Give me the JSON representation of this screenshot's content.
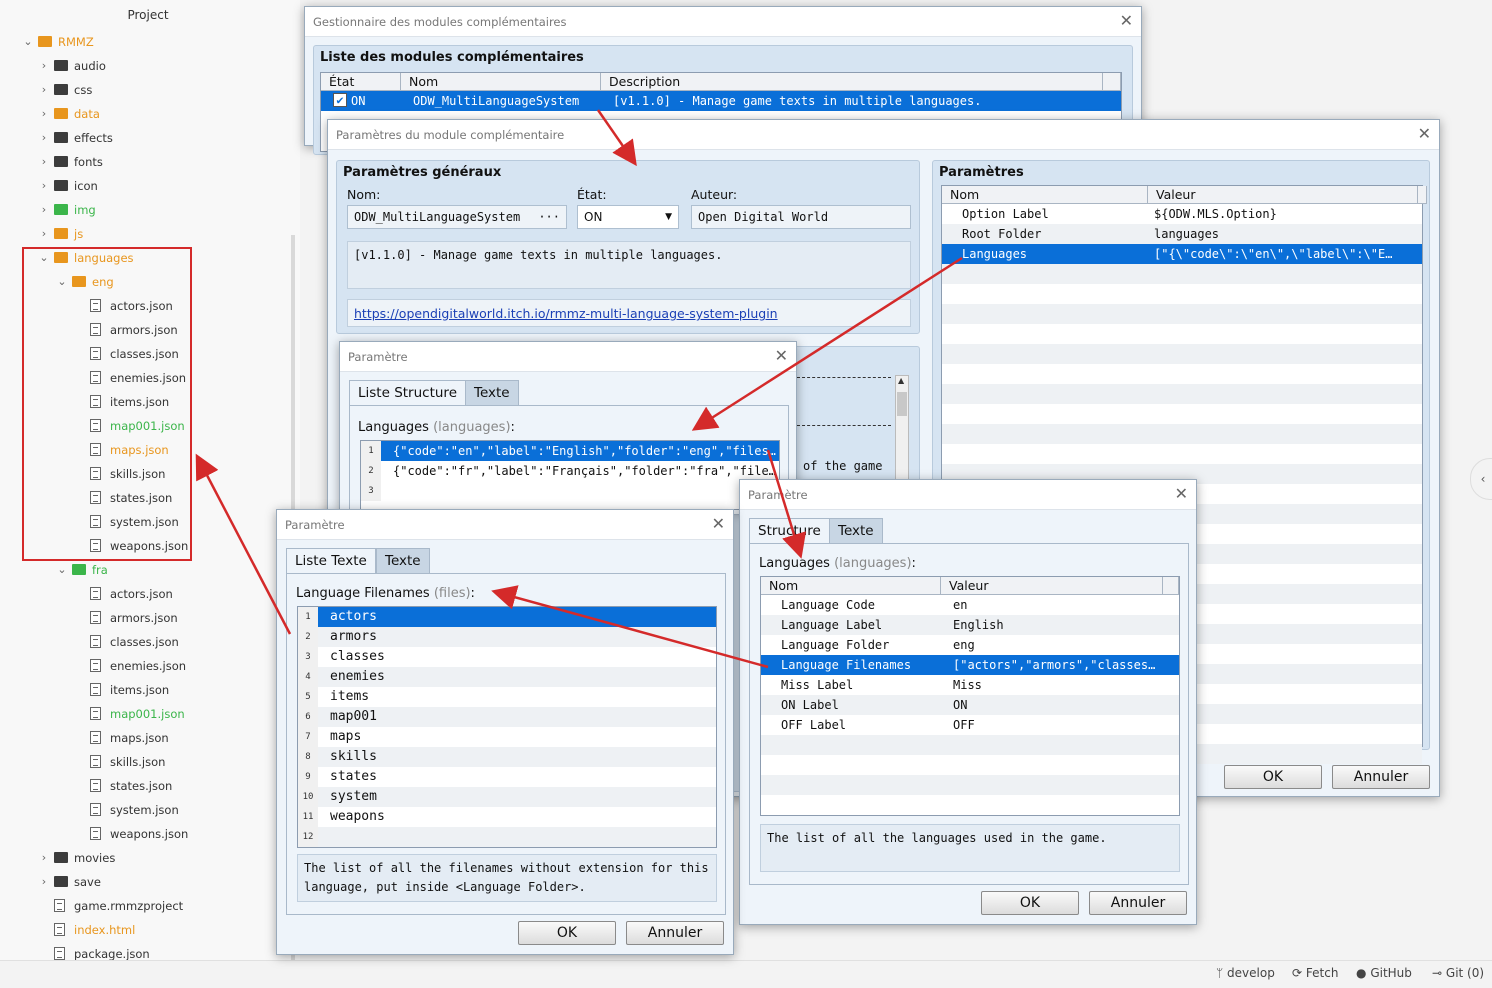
{
  "explorer": {
    "title": "Project",
    "items": [
      {
        "label": "RMMZ",
        "color": "orange",
        "chev": "v",
        "icon": "folder-orange",
        "indent": 0
      },
      {
        "label": "audio",
        "color": "",
        "chev": ">",
        "icon": "folder",
        "indent": 1
      },
      {
        "label": "css",
        "color": "",
        "chev": ">",
        "icon": "folder",
        "indent": 1
      },
      {
        "label": "data",
        "color": "orange",
        "chev": ">",
        "icon": "folder-orange",
        "indent": 1
      },
      {
        "label": "effects",
        "color": "",
        "chev": ">",
        "icon": "folder",
        "indent": 1
      },
      {
        "label": "fonts",
        "color": "",
        "chev": ">",
        "icon": "folder",
        "indent": 1
      },
      {
        "label": "icon",
        "color": "",
        "chev": ">",
        "icon": "folder",
        "indent": 1
      },
      {
        "label": "img",
        "color": "green",
        "chev": ">",
        "icon": "folder-green",
        "indent": 1
      },
      {
        "label": "js",
        "color": "orange",
        "chev": ">",
        "icon": "folder-orange",
        "indent": 1
      },
      {
        "label": "languages",
        "color": "orange",
        "chev": "v",
        "icon": "folder-orange",
        "indent": 1
      },
      {
        "label": "eng",
        "color": "orange",
        "chev": "v",
        "icon": "folder-orange",
        "indent": 2
      },
      {
        "label": "actors.json",
        "color": "",
        "chev": "",
        "icon": "file",
        "indent": 3
      },
      {
        "label": "armors.json",
        "color": "",
        "chev": "",
        "icon": "file",
        "indent": 3
      },
      {
        "label": "classes.json",
        "color": "",
        "chev": "",
        "icon": "file",
        "indent": 3
      },
      {
        "label": "enemies.json",
        "color": "",
        "chev": "",
        "icon": "file",
        "indent": 3
      },
      {
        "label": "items.json",
        "color": "",
        "chev": "",
        "icon": "file",
        "indent": 3
      },
      {
        "label": "map001.json",
        "color": "green",
        "chev": "",
        "icon": "file",
        "indent": 3
      },
      {
        "label": "maps.json",
        "color": "orange",
        "chev": "",
        "icon": "file",
        "indent": 3
      },
      {
        "label": "skills.json",
        "color": "",
        "chev": "",
        "icon": "file",
        "indent": 3
      },
      {
        "label": "states.json",
        "color": "",
        "chev": "",
        "icon": "file",
        "indent": 3
      },
      {
        "label": "system.json",
        "color": "",
        "chev": "",
        "icon": "file",
        "indent": 3
      },
      {
        "label": "weapons.json",
        "color": "",
        "chev": "",
        "icon": "file",
        "indent": 3
      },
      {
        "label": "fra",
        "color": "green",
        "chev": "v",
        "icon": "folder-green",
        "indent": 2
      },
      {
        "label": "actors.json",
        "color": "",
        "chev": "",
        "icon": "file",
        "indent": 3
      },
      {
        "label": "armors.json",
        "color": "",
        "chev": "",
        "icon": "file",
        "indent": 3
      },
      {
        "label": "classes.json",
        "color": "",
        "chev": "",
        "icon": "file",
        "indent": 3
      },
      {
        "label": "enemies.json",
        "color": "",
        "chev": "",
        "icon": "file",
        "indent": 3
      },
      {
        "label": "items.json",
        "color": "",
        "chev": "",
        "icon": "file",
        "indent": 3
      },
      {
        "label": "map001.json",
        "color": "green",
        "chev": "",
        "icon": "file",
        "indent": 3
      },
      {
        "label": "maps.json",
        "color": "",
        "chev": "",
        "icon": "file",
        "indent": 3
      },
      {
        "label": "skills.json",
        "color": "",
        "chev": "",
        "icon": "file",
        "indent": 3
      },
      {
        "label": "states.json",
        "color": "",
        "chev": "",
        "icon": "file",
        "indent": 3
      },
      {
        "label": "system.json",
        "color": "",
        "chev": "",
        "icon": "file",
        "indent": 3
      },
      {
        "label": "weapons.json",
        "color": "",
        "chev": "",
        "icon": "file",
        "indent": 3
      },
      {
        "label": "movies",
        "color": "",
        "chev": ">",
        "icon": "folder",
        "indent": 1
      },
      {
        "label": "save",
        "color": "",
        "chev": ">",
        "icon": "folder",
        "indent": 1
      },
      {
        "label": "game.rmmzproject",
        "color": "",
        "chev": "",
        "icon": "file",
        "indent": 1
      },
      {
        "label": "index.html",
        "color": "orange",
        "chev": "",
        "icon": "file",
        "indent": 1
      },
      {
        "label": "package.json",
        "color": "",
        "chev": "",
        "icon": "file",
        "indent": 1
      }
    ]
  },
  "statusbar": {
    "branch": "develop",
    "fetch": "Fetch",
    "github": "GitHub",
    "git": "Git (0)"
  },
  "manager": {
    "title": "Gestionnaire des modules complémentaires",
    "panel_title": "Liste des modules complémentaires",
    "col_state": "État",
    "col_name": "Nom",
    "col_desc": "Description",
    "row": {
      "state": "ON",
      "name": "ODW_MultiLanguageSystem",
      "desc": "[v1.1.0] - Manage game texts in multiple languages."
    }
  },
  "plugin_params": {
    "title": "Paramètres du module complémentaire",
    "general_title": "Paramètres généraux",
    "name_label": "Nom:",
    "name_value": "ODW_MultiLanguageSystem",
    "ellipsis": "···",
    "state_label": "État:",
    "state_value": "ON",
    "author_label": "Auteur:",
    "author_value": "Open Digital World",
    "description": "[v1.1.0] - Manage game texts in multiple languages.",
    "link": "https://opendigitalworld.itch.io/rmmz-multi-language-system-plugin",
    "params_title": "Paramètres",
    "col_name": "Nom",
    "col_value": "Valeur",
    "rows": [
      {
        "name": "Option Label",
        "value": "${ODW.MLS.Option}"
      },
      {
        "name": "Root Folder",
        "value": "languages"
      },
      {
        "name": "Languages",
        "value": "[\"{\\\"code\\\":\\\"en\\\",\\\"label\\\":\\\"E…"
      }
    ],
    "ok": "OK",
    "cancel": "Annuler",
    "behind_text": "of the game"
  },
  "param_list": {
    "title": "Paramètre",
    "tab1": "Liste Structure",
    "tab2": "Texte",
    "label": "Languages",
    "label_key": "(languages)",
    "colon": ":",
    "rows": [
      "{\"code\":\"en\",\"label\":\"English\",\"folder\":\"eng\",\"files…",
      "{\"code\":\"fr\",\"label\":\"Français\",\"folder\":\"fra\",\"file…",
      ""
    ]
  },
  "param_struct": {
    "title": "Paramètre",
    "tab1": "Structure",
    "tab2": "Texte",
    "label": "Languages",
    "label_key": "(languages)",
    "colon": ":",
    "col_name": "Nom",
    "col_value": "Valeur",
    "rows": [
      {
        "name": "Language Code",
        "value": "en"
      },
      {
        "name": "Language Label",
        "value": "English"
      },
      {
        "name": "Language Folder",
        "value": "eng"
      },
      {
        "name": "Language Filenames",
        "value": "[\"actors\",\"armors\",\"classes…"
      },
      {
        "name": "Miss Label",
        "value": "Miss"
      },
      {
        "name": "ON Label",
        "value": "ON"
      },
      {
        "name": "OFF Label",
        "value": "OFF"
      }
    ],
    "description": "The list of all the languages used in the game.",
    "ok": "OK",
    "cancel": "Annuler"
  },
  "param_text": {
    "title": "Paramètre",
    "tab1": "Liste Texte",
    "tab2": "Texte",
    "label": "Language Filenames",
    "label_key": "(files)",
    "colon": ":",
    "rows": [
      "actors",
      "armors",
      "classes",
      "enemies",
      "items",
      "map001",
      "maps",
      "skills",
      "states",
      "system",
      "weapons",
      ""
    ],
    "description": "The list of all the filenames without extension for this language, put inside <Language Folder>.",
    "ok": "OK",
    "cancel": "Annuler"
  },
  "colors": {
    "accent": "#0a6fd8",
    "red": "#d42a2a",
    "orange": "#e8961e",
    "green": "#3bb54a"
  }
}
